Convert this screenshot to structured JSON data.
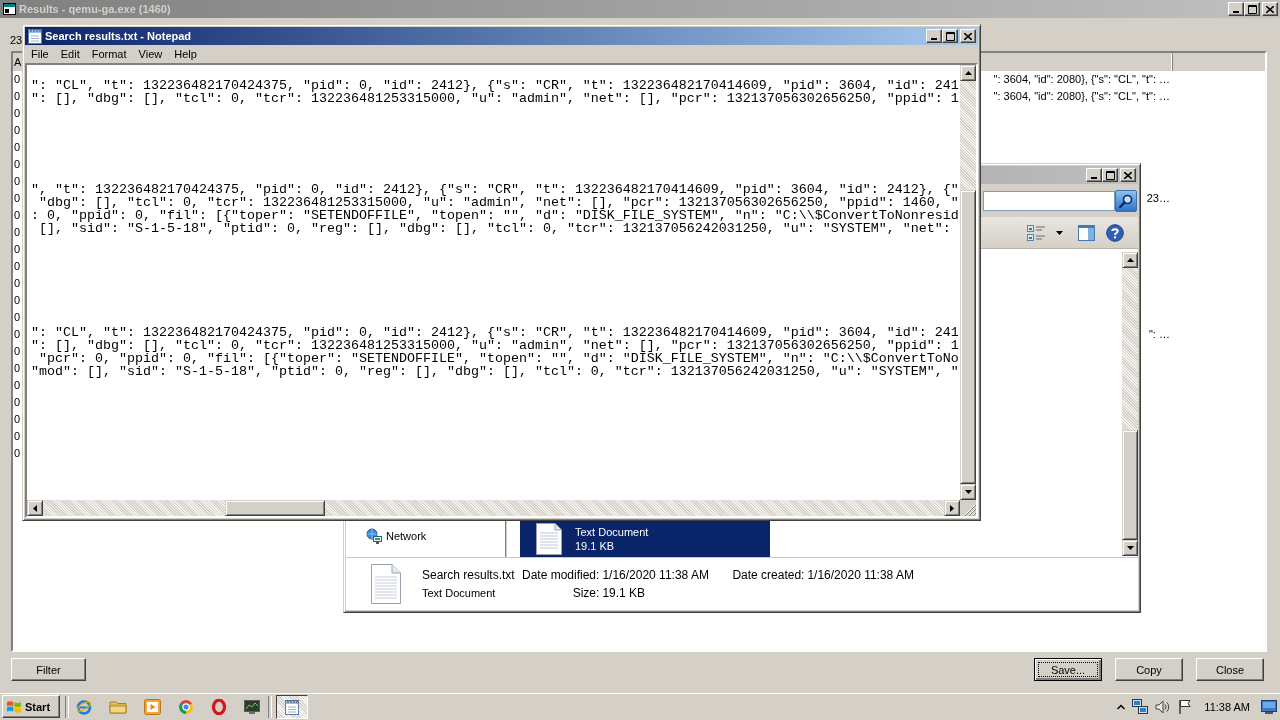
{
  "results_window": {
    "title": "Results - qemu-ga.exe (1460)",
    "summary": "23",
    "columns": [
      "A"
    ],
    "rows": [
      {
        "left_text": "0",
        "right_text": "\": 3604, \"id\": 2080}, {\"s\": \"CL\", \"t\": …"
      },
      {
        "left_text": "0",
        "right_text": "\": 3604, \"id\": 2080}, {\"s\": \"CL\", \"t\": …"
      },
      {
        "left_text": "0"
      },
      {
        "left_text": "0"
      },
      {
        "left_text": "0"
      },
      {
        "left_text": "0"
      },
      {
        "left_text": "0"
      },
      {
        "left_text": "0",
        "right_text": "23…"
      },
      {
        "left_text": "0"
      },
      {
        "left_text": "0"
      },
      {
        "left_text": "0"
      },
      {
        "left_text": "0"
      },
      {
        "left_text": "0"
      },
      {
        "left_text": "0"
      },
      {
        "left_text": "0"
      },
      {
        "left_text": "0",
        "right_text": "\": …"
      },
      {
        "left_text": "0"
      },
      {
        "left_text": "0"
      },
      {
        "left_text": "0"
      },
      {
        "left_text": "0"
      },
      {
        "left_text": "0"
      },
      {
        "left_text": "0"
      },
      {
        "left_text": "0"
      }
    ],
    "left_buttons": [
      {
        "label": "Filter",
        "default": false
      }
    ],
    "right_buttons": [
      {
        "label": "Save...",
        "default": true
      },
      {
        "label": "Copy",
        "default": false
      },
      {
        "label": "Close",
        "default": false
      }
    ]
  },
  "explorer_window": {
    "nav_items": [
      {
        "label": "Network",
        "selected": false
      }
    ],
    "files": [
      {
        "type": "Text Document",
        "size": "19.1 KB",
        "selected": true
      }
    ],
    "details": {
      "name": "Search results.txt",
      "type": "Text Document",
      "fields": [
        {
          "label": "Date modified:",
          "value": "1/16/2020 11:38 AM"
        },
        {
          "label": "Size:",
          "value": "19.1 KB"
        },
        {
          "label": "Date created:",
          "value": "1/16/2020 11:38 AM"
        }
      ]
    }
  },
  "notepad": {
    "title": "Search results.txt - Notepad",
    "menu": [
      "File",
      "Edit",
      "Format",
      "View",
      "Help"
    ],
    "blocks": [
      {
        "lines": [
          "\": \"CL\", \"t\": 132236482170424375, \"pid\": 0, \"id\": 2412}, {\"s\": \"CR\", \"t\": 132236482170414609, \"pid\": 3604, \"id\": 241",
          "\": [], \"dbg\": [], \"tcl\": 0, \"tcr\": 132236481253315000, \"u\": \"admin\", \"net\": [], \"pcr\": 132137056302656250, \"ppid\": 1"
        ]
      },
      {
        "lines": [
          "\", \"t\": 132236482170424375, \"pid\": 0, \"id\": 2412}, {\"s\": \"CR\", \"t\": 132236482170414609, \"pid\": 3604, \"id\": 2412}, {\"",
          " \"dbg\": [], \"tcl\": 0, \"tcr\": 132236481253315000, \"u\": \"admin\", \"net\": [], \"pcr\": 132137056302656250, \"ppid\": 1460, \"",
          ": 0, \"ppid\": 0, \"fil\": [{\"toper\": \"SETENDOFFILE\", \"topen\": \"\", \"d\": \"DISK_FILE_SYSTEM\", \"n\": \"C:\\\\$ConvertToNonresid",
          " [], \"sid\": \"S-1-5-18\", \"ptid\": 0, \"reg\": [], \"dbg\": [], \"tcl\": 0, \"tcr\": 132137056242031250, \"u\": \"SYSTEM\", \"net\":"
        ]
      },
      {
        "lines": [
          "\": \"CL\", \"t\": 132236482170424375, \"pid\": 0, \"id\": 2412}, {\"s\": \"CR\", \"t\": 132236482170414609, \"pid\": 3604, \"id\": 241",
          "\": [], \"dbg\": [], \"tcl\": 0, \"tcr\": 132236481253315000, \"u\": \"admin\", \"net\": [], \"pcr\": 132137056302656250, \"ppid\": 1",
          " \"pcr\": 0, \"ppid\": 0, \"fil\": [{\"toper\": \"SETENDOFFILE\", \"topen\": \"\", \"d\": \"DISK_FILE_SYSTEM\", \"n\": \"C:\\\\$ConvertToNo",
          "\"mod\": [], \"sid\": \"S-1-5-18\", \"ptid\": 0, \"reg\": [], \"dbg\": [], \"tcl\": 0, \"tcr\": 132137056242031250, \"u\": \"SYSTEM\", \""
        ]
      }
    ]
  },
  "taskbar": {
    "start": "Start",
    "tasks": [
      {
        "selected": true
      }
    ],
    "clock": "11:38 AM"
  }
}
